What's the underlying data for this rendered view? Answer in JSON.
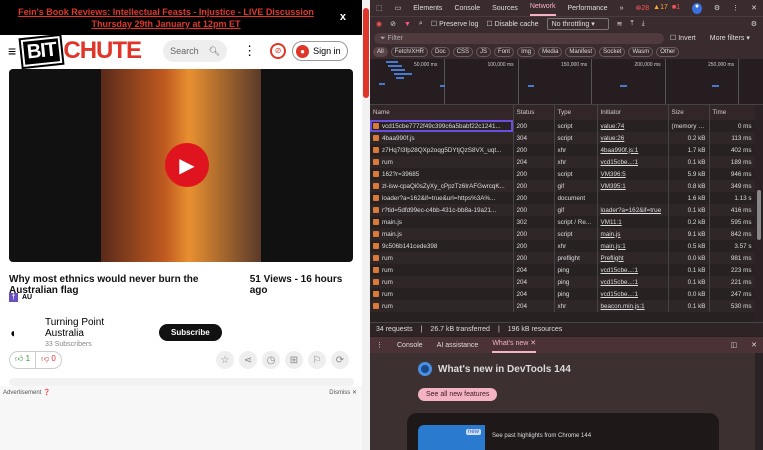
{
  "page": {
    "banner": "Fein's Book Reviews: Intellectual Feasts - Injustice - LIVE Discussion Thursday 29th January at 12pm ET",
    "banner_close": "x",
    "logo": {
      "bit": "BIT",
      "chute": "CHUTE"
    },
    "search_placeholder": "Search",
    "sign_in": "Sign in",
    "video_title": "Why most ethnics would never burn the Australian flag",
    "views": "51 Views - 16 hours ago",
    "category": "AU",
    "channel": "Turning Point Australia",
    "subscribers": "33 Subscribers",
    "subscribe": "Subscribe",
    "likes": "1",
    "dislikes": "0",
    "ad_label": "Advertisement",
    "dismiss": "Dismiss"
  },
  "devtools": {
    "tabs": [
      "Elements",
      "Console",
      "Sources",
      "Network",
      "Performance"
    ],
    "errors": "28",
    "warnings": "17",
    "issues": "1",
    "preserve_log": "Preserve log",
    "disable_cache": "Disable cache",
    "throttling": "No throttling",
    "filter_placeholder": "Filter",
    "invert": "Invert",
    "more_filters": "More filters",
    "chips": [
      "All",
      "Fetch/XHR",
      "Doc",
      "CSS",
      "JS",
      "Font",
      "Img",
      "Media",
      "Manifest",
      "Socket",
      "Wasm",
      "Other"
    ],
    "timeline_labels": [
      "50,000 ms",
      "100,000 ms",
      "150,000 ms",
      "200,000 ms",
      "250,000 ms"
    ],
    "columns": [
      "Name",
      "Status",
      "Type",
      "Initiator",
      "Size",
      "Time"
    ],
    "rows": [
      [
        "vcd15cbe7772f49c399c6a5babf22c1241...",
        "200",
        "script",
        "value:74",
        "(memory c...",
        "0 ms"
      ],
      [
        "4baa990f.js",
        "304",
        "script",
        "value:26",
        "0.2 kB",
        "113 ms"
      ],
      [
        "z7Hq7I3fp28QXp2oqg5DYtjQzS8VX_uqt...",
        "200",
        "xhr",
        "4baa990f.js:1",
        "1.7 kB",
        "402 ms"
      ],
      [
        "rum",
        "204",
        "xhr",
        "vcd15cbe...:1",
        "0.1 kB",
        "189 ms"
      ],
      [
        "162?r=39685",
        "200",
        "script",
        "VM396:5",
        "5.9 kB",
        "946 ms"
      ],
      [
        "zl-isw-cpaQi0sZyXy_cPpzTz6IrAFGwrcqK...",
        "200",
        "gif",
        "VM395:1",
        "0.8 kB",
        "349 ms"
      ],
      [
        "loader?a=162&if=true&url=https%3A%...",
        "200",
        "document",
        "",
        "1.6 kB",
        "1.13 s"
      ],
      [
        "r?tid=5dfd99ec-c4bb-431c-bb8a-19a21...",
        "200",
        "gif",
        "loader?a=162&if=true",
        "0.1 kB",
        "416 ms"
      ],
      [
        "main.js",
        "302",
        "script / Re...",
        "VM11:1",
        "0.2 kB",
        "595 ms"
      ],
      [
        "main.js",
        "200",
        "script",
        "main.js",
        "9.1 kB",
        "842 ms"
      ],
      [
        "9c506b141cede398",
        "200",
        "xhr",
        "main.js:1",
        "0.5 kB",
        "3.57 s"
      ],
      [
        "rum",
        "200",
        "preflight",
        "Preflight",
        "0.0 kB",
        "981 ms"
      ],
      [
        "rum",
        "204",
        "ping",
        "vcd15cbe...:1",
        "0.1 kB",
        "223 ms"
      ],
      [
        "rum",
        "204",
        "ping",
        "vcd15cbe...:1",
        "0.1 kB",
        "221 ms"
      ],
      [
        "rum",
        "204",
        "ping",
        "vcd15cbe...:1",
        "0.0 kB",
        "247 ms"
      ],
      [
        "rum",
        "204",
        "xhr",
        "beacon.min.js:1",
        "0.1 kB",
        "530 ms"
      ]
    ],
    "footer": [
      "34 requests",
      "26.7 kB transferred",
      "196 kB resources"
    ],
    "drawer_tabs": [
      "Console",
      "AI assistance",
      "What's new"
    ],
    "whats_new_title": "What's new in DevTools 144",
    "see_all": "See all new features",
    "badge_new": "new",
    "highlights": "See past highlights from Chrome 144"
  }
}
